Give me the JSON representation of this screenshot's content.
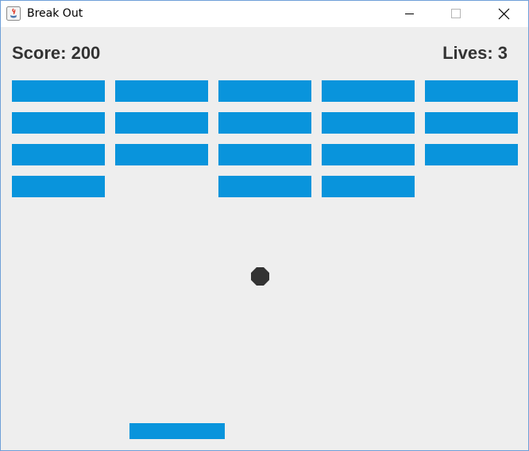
{
  "window": {
    "title": "Break Out"
  },
  "hud": {
    "score_text": "Score: 200",
    "lives_text": "Lives: 3"
  },
  "game": {
    "score": 200,
    "lives": 3,
    "brick_color": "#0994dc",
    "ball_color": "#333333",
    "background_color": "#eeeeee",
    "brick_rows": [
      [
        true,
        true,
        true,
        true,
        true
      ],
      [
        true,
        true,
        true,
        true,
        true
      ],
      [
        true,
        true,
        true,
        true,
        true
      ],
      [
        true,
        false,
        true,
        true,
        false
      ]
    ]
  }
}
